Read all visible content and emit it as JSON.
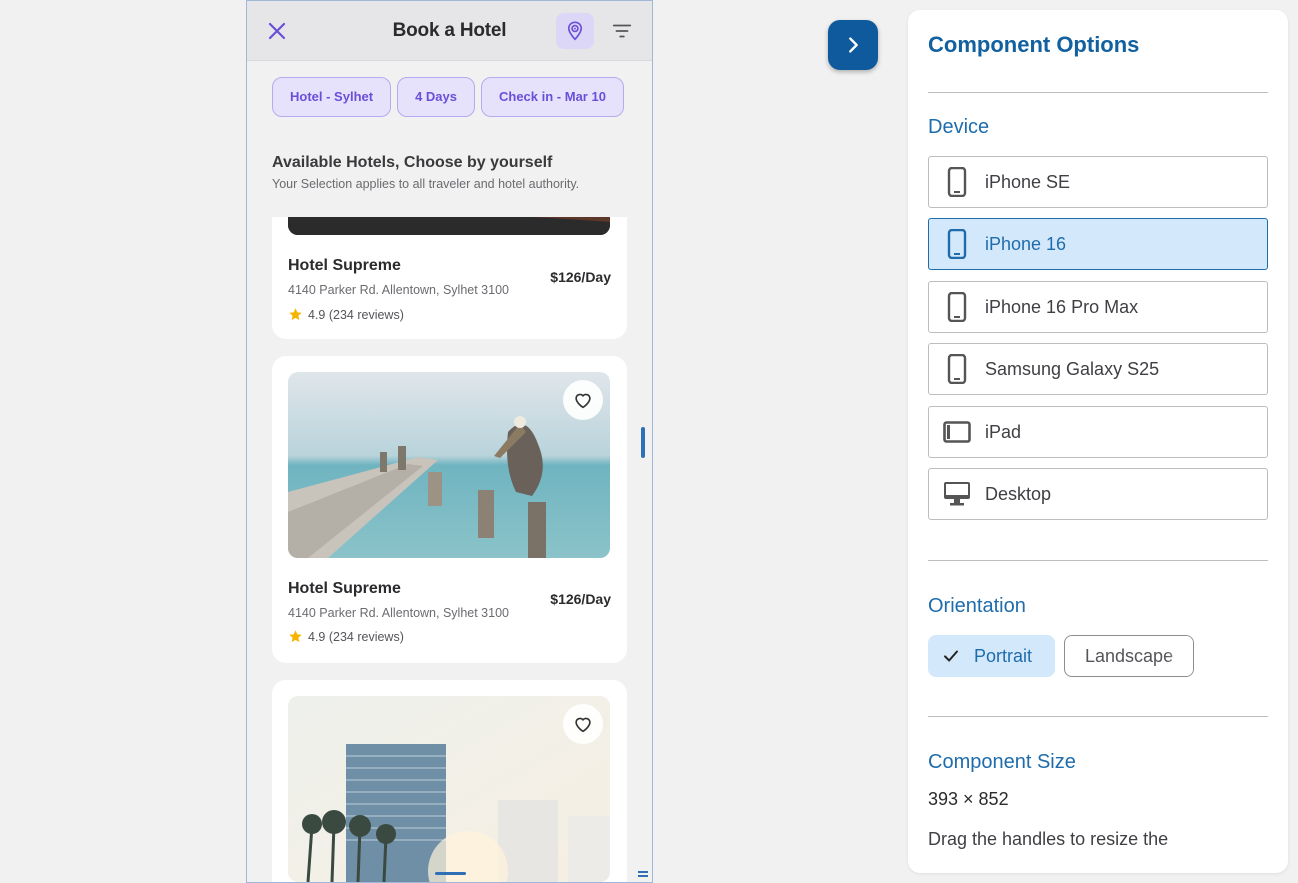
{
  "phone": {
    "title": "Book a Hotel",
    "chips": [
      "Hotel - Sylhet",
      "4 Days",
      "Check in - Mar 10"
    ],
    "section_title": "Available Hotels, Choose by yourself",
    "section_subtitle": "Your Selection applies to all traveler and hotel authority.",
    "hotels": [
      {
        "name": "Hotel Supreme",
        "address": "4140 Parker Rd. Allentown, Sylhet 3100",
        "price": "$126/Day",
        "rating": "4.9 (234 reviews)"
      },
      {
        "name": "Hotel Supreme",
        "address": "4140 Parker Rd. Allentown, Sylhet 3100",
        "price": "$126/Day",
        "rating": "4.9 (234 reviews)"
      }
    ]
  },
  "panel": {
    "title": "Component Options",
    "device_heading": "Device",
    "devices": [
      {
        "label": "iPhone SE",
        "icon": "phone-icon",
        "selected": false
      },
      {
        "label": "iPhone 16",
        "icon": "phone-icon",
        "selected": true
      },
      {
        "label": "iPhone 16 Pro Max",
        "icon": "phone-icon",
        "selected": false
      },
      {
        "label": "Samsung Galaxy S25",
        "icon": "phone-icon",
        "selected": false
      },
      {
        "label": "iPad",
        "icon": "tablet-icon",
        "selected": false
      },
      {
        "label": "Desktop",
        "icon": "desktop-icon",
        "selected": false
      }
    ],
    "orientation_heading": "Orientation",
    "orientation": {
      "portrait": "Portrait",
      "landscape": "Landscape",
      "selected": "portrait"
    },
    "size_heading": "Component Size",
    "size_value": "393 × 852",
    "help_text": "Drag the handles to resize the"
  },
  "colors": {
    "accent": "#1e6cac",
    "chip_text": "#6a4fd8",
    "toggle_bg": "#0e5a9c",
    "star": "#f5b400"
  }
}
